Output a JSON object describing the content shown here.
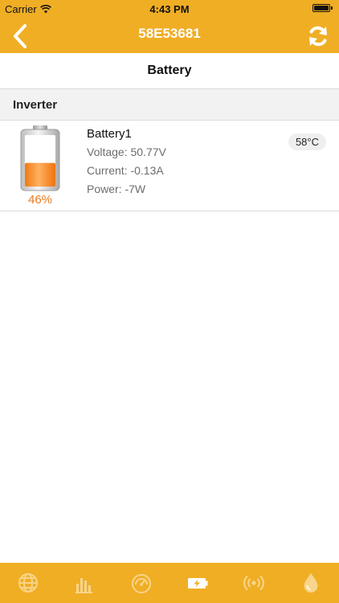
{
  "status_bar": {
    "carrier": "Carrier",
    "time": "4:43 PM"
  },
  "header": {
    "title": "58E53681",
    "back_icon": "chevron-left-icon",
    "refresh_icon": "refresh-icon"
  },
  "page_title": "Battery",
  "group": {
    "title": "Inverter"
  },
  "battery": {
    "name": "Battery1",
    "voltage": "Voltage: 50.77V",
    "current": "Current: -0.13A",
    "power": "Power: -7W",
    "percent": "46%",
    "level": 0.46,
    "temperature": "58°C"
  },
  "tabs": [
    {
      "icon": "globe-icon",
      "active": false
    },
    {
      "icon": "bar-chart-icon",
      "active": false
    },
    {
      "icon": "gauge-icon",
      "active": false
    },
    {
      "icon": "battery-charging-icon",
      "active": true
    },
    {
      "icon": "signal-broadcast-icon",
      "active": false
    },
    {
      "icon": "droplet-icon",
      "active": false
    }
  ],
  "colors": {
    "accent": "#f0ae25",
    "percent": "#e87a1e",
    "tab_inactive": "#f7d58a"
  }
}
